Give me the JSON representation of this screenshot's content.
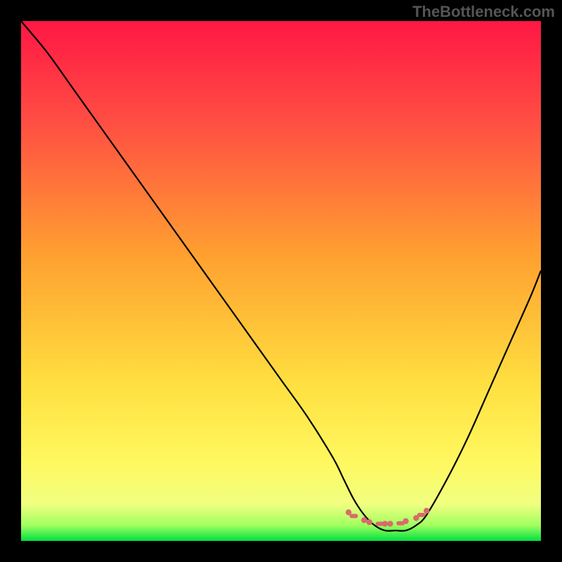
{
  "watermark": "TheBottleneck.com",
  "chart_data": {
    "type": "line",
    "title": "",
    "xlabel": "",
    "ylabel": "",
    "xlim": [
      0,
      100
    ],
    "ylim": [
      0,
      100
    ],
    "background_gradient": {
      "stops": [
        {
          "offset": 0,
          "color": "#ff1744"
        },
        {
          "offset": 20,
          "color": "#ff5043"
        },
        {
          "offset": 45,
          "color": "#ffa030"
        },
        {
          "offset": 70,
          "color": "#ffe040"
        },
        {
          "offset": 85,
          "color": "#fff860"
        },
        {
          "offset": 93,
          "color": "#f0ff80"
        },
        {
          "offset": 97,
          "color": "#a0ff60"
        },
        {
          "offset": 100,
          "color": "#00e040"
        }
      ]
    },
    "series": [
      {
        "name": "bottleneck-curve",
        "color": "#000000",
        "x": [
          0,
          5,
          10,
          15,
          20,
          25,
          30,
          35,
          40,
          45,
          50,
          55,
          60,
          62,
          64,
          66,
          68,
          70,
          72,
          74,
          76,
          78,
          82,
          86,
          90,
          94,
          98,
          100
        ],
        "y": [
          100,
          94,
          87,
          80,
          73,
          66,
          59,
          52,
          45,
          38,
          31,
          24,
          16,
          12,
          8,
          5,
          3,
          2,
          2,
          2,
          3,
          5,
          12,
          20,
          29,
          38,
          47,
          52
        ]
      }
    ],
    "markers": {
      "name": "optimal-range",
      "color": "#d96a6a",
      "points": [
        {
          "x": 63,
          "y": 5.5
        },
        {
          "x": 64,
          "y": 4.8
        },
        {
          "x": 66,
          "y": 4.0
        },
        {
          "x": 67,
          "y": 3.6
        },
        {
          "x": 69,
          "y": 3.3
        },
        {
          "x": 70,
          "y": 3.3
        },
        {
          "x": 71,
          "y": 3.3
        },
        {
          "x": 73,
          "y": 3.4
        },
        {
          "x": 74,
          "y": 3.8
        },
        {
          "x": 76,
          "y": 4.4
        },
        {
          "x": 77,
          "y": 5.0
        },
        {
          "x": 78,
          "y": 5.8
        }
      ]
    }
  }
}
